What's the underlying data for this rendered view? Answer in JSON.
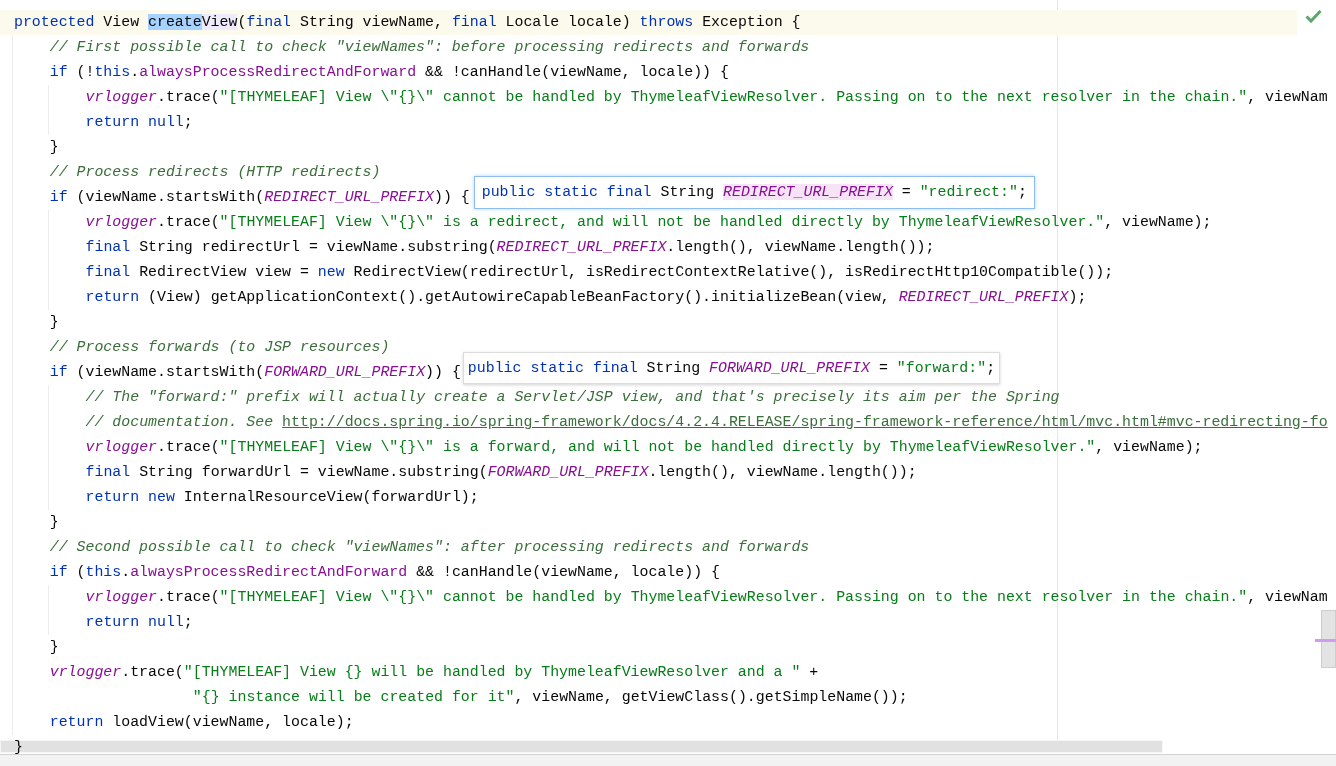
{
  "editor": {
    "lines": [
      {
        "current": true,
        "tokens": [
          {
            "kind": "keyword",
            "text": "protected"
          },
          {
            "kind": "plain",
            "text": " View "
          },
          {
            "kind": "selection",
            "text": "create"
          },
          {
            "kind": "usage",
            "text": "View"
          },
          {
            "kind": "plain",
            "text": "("
          },
          {
            "kind": "keyword",
            "text": "final"
          },
          {
            "kind": "plain",
            "text": " String viewName, "
          },
          {
            "kind": "keyword",
            "text": "final"
          },
          {
            "kind": "plain",
            "text": " Locale locale) "
          },
          {
            "kind": "keyword",
            "text": "throws"
          },
          {
            "kind": "plain",
            "text": " Exception {"
          }
        ],
        "children": [
          {
            "current": false,
            "tokens": [
              {
                "kind": "comment",
                "text": "// First possible call to check \"viewNames\": before processing redirects and forwards"
              }
            ]
          },
          {
            "current": false,
            "tokens": [
              {
                "kind": "keyword",
                "text": "if"
              },
              {
                "kind": "plain",
                "text": " (!"
              },
              {
                "kind": "keyword",
                "text": "this"
              },
              {
                "kind": "plain",
                "text": "."
              },
              {
                "kind": "field",
                "text": "alwaysProcessRedirectAndForward"
              },
              {
                "kind": "plain",
                "text": " && !canHandle(viewName, locale)) {"
              }
            ],
            "children": [
              {
                "current": false,
                "tokens": [
                  {
                    "kind": "static",
                    "text": "vrlogger"
                  },
                  {
                    "kind": "plain",
                    "text": ".trace("
                  },
                  {
                    "kind": "string",
                    "text": "\"[THYMELEAF] View \\\"{}\\\" cannot be handled by ThymeleafViewResolver. Passing on to the next resolver in the chain.\""
                  },
                  {
                    "kind": "plain",
                    "text": ", viewNam"
                  }
                ]
              },
              {
                "current": false,
                "tokens": [
                  {
                    "kind": "keyword",
                    "text": "return null"
                  },
                  {
                    "kind": "plain",
                    "text": ";"
                  }
                ]
              }
            ]
          },
          {
            "current": false,
            "tokens": [
              {
                "kind": "plain",
                "text": "}"
              }
            ]
          },
          {
            "current": false,
            "tokens": [
              {
                "kind": "comment",
                "text": "// Process redirects (HTTP redirects)"
              }
            ]
          },
          {
            "current": false,
            "tokens": [
              {
                "kind": "keyword",
                "text": "if"
              },
              {
                "kind": "plain",
                "text": " (viewName.startsWith("
              },
              {
                "kind": "static",
                "text": "REDIRECT_URL_PREFIX"
              },
              {
                "kind": "plain",
                "text": ")) {"
              }
            ],
            "popup": {
              "focused": true,
              "tokens": [
                {
                  "kind": "keyword",
                  "text": "public static final"
                },
                {
                  "kind": "plain",
                  "text": " String "
                },
                {
                  "kind": "highlighted",
                  "text": "REDIRECT_URL_PREFIX"
                },
                {
                  "kind": "plain",
                  "text": " = "
                },
                {
                  "kind": "string",
                  "text": "\"redirect:\""
                },
                {
                  "kind": "plain",
                  "text": ";"
                }
              ]
            },
            "children": [
              {
                "current": false,
                "tokens": [
                  {
                    "kind": "static",
                    "text": "vrlogger"
                  },
                  {
                    "kind": "plain",
                    "text": ".trace("
                  },
                  {
                    "kind": "string",
                    "text": "\"[THYMELEAF] View \\\"{}\\\" is a redirect, and will not be handled directly by ThymeleafViewResolver.\""
                  },
                  {
                    "kind": "plain",
                    "text": ", viewName);"
                  }
                ]
              },
              {
                "current": false,
                "tokens": [
                  {
                    "kind": "keyword",
                    "text": "final"
                  },
                  {
                    "kind": "plain",
                    "text": " String redirectUrl = viewName.substring("
                  },
                  {
                    "kind": "static",
                    "text": "REDIRECT_URL_PREFIX"
                  },
                  {
                    "kind": "plain",
                    "text": ".length(), viewName.length());"
                  }
                ]
              },
              {
                "current": false,
                "tokens": [
                  {
                    "kind": "keyword",
                    "text": "final"
                  },
                  {
                    "kind": "plain",
                    "text": " RedirectView view = "
                  },
                  {
                    "kind": "keyword",
                    "text": "new"
                  },
                  {
                    "kind": "plain",
                    "text": " RedirectView(redirectUrl, isRedirectContextRelative(), isRedirectHttp10Compatible());"
                  }
                ]
              },
              {
                "current": false,
                "tokens": [
                  {
                    "kind": "keyword",
                    "text": "return"
                  },
                  {
                    "kind": "plain",
                    "text": " (View) getApplicationContext().getAutowireCapableBeanFactory().initializeBean(view, "
                  },
                  {
                    "kind": "static",
                    "text": "REDIRECT_URL_PREFIX"
                  },
                  {
                    "kind": "plain",
                    "text": ");"
                  }
                ]
              }
            ]
          },
          {
            "current": false,
            "tokens": [
              {
                "kind": "plain",
                "text": "}"
              }
            ]
          },
          {
            "current": false,
            "tokens": [
              {
                "kind": "comment",
                "text": "// Process forwards (to JSP resources)"
              }
            ]
          },
          {
            "current": false,
            "tokens": [
              {
                "kind": "keyword",
                "text": "if"
              },
              {
                "kind": "plain",
                "text": " (viewName.startsWith("
              },
              {
                "kind": "static",
                "text": "FORWARD_URL_PREFIX"
              },
              {
                "kind": "plain",
                "text": ")) {"
              }
            ],
            "popup": {
              "focused": false,
              "tokens": [
                {
                  "kind": "keyword",
                  "text": "public static final"
                },
                {
                  "kind": "plain",
                  "text": " String "
                },
                {
                  "kind": "static",
                  "text": "FORWARD_URL_PREFIX"
                },
                {
                  "kind": "plain",
                  "text": " = "
                },
                {
                  "kind": "string",
                  "text": "\"forward:\""
                },
                {
                  "kind": "plain",
                  "text": ";"
                }
              ]
            },
            "children": [
              {
                "current": false,
                "tokens": [
                  {
                    "kind": "comment",
                    "text": "// The \"forward:\" prefix will actually create a Servlet/JSP view, and that's precisely its aim per the Spring"
                  }
                ]
              },
              {
                "current": false,
                "tokens": [
                  {
                    "kind": "comment",
                    "text": "// documentation. See "
                  },
                  {
                    "kind": "link",
                    "text": "http://docs.spring.io/spring-framework/docs/4.2.4.RELEASE/spring-framework-reference/html/mvc.html#mvc-redirecting-fo"
                  }
                ]
              },
              {
                "current": false,
                "tokens": [
                  {
                    "kind": "static",
                    "text": "vrlogger"
                  },
                  {
                    "kind": "plain",
                    "text": ".trace("
                  },
                  {
                    "kind": "string",
                    "text": "\"[THYMELEAF] View \\\"{}\\\" is a forward, and will not be handled directly by ThymeleafViewResolver.\""
                  },
                  {
                    "kind": "plain",
                    "text": ", viewName);"
                  }
                ]
              },
              {
                "current": false,
                "tokens": [
                  {
                    "kind": "keyword",
                    "text": "final"
                  },
                  {
                    "kind": "plain",
                    "text": " String forwardUrl = viewName.substring("
                  },
                  {
                    "kind": "static",
                    "text": "FORWARD_URL_PREFIX"
                  },
                  {
                    "kind": "plain",
                    "text": ".length(), viewName.length());"
                  }
                ]
              },
              {
                "current": false,
                "tokens": [
                  {
                    "kind": "keyword",
                    "text": "return new"
                  },
                  {
                    "kind": "plain",
                    "text": " InternalResourceView(forwardUrl);"
                  }
                ]
              }
            ]
          },
          {
            "current": false,
            "tokens": [
              {
                "kind": "plain",
                "text": "}"
              }
            ]
          },
          {
            "current": false,
            "tokens": [
              {
                "kind": "comment",
                "text": "// Second possible call to check \"viewNames\": after processing redirects and forwards"
              }
            ]
          },
          {
            "current": false,
            "tokens": [
              {
                "kind": "keyword",
                "text": "if"
              },
              {
                "kind": "plain",
                "text": " ("
              },
              {
                "kind": "keyword",
                "text": "this"
              },
              {
                "kind": "plain",
                "text": "."
              },
              {
                "kind": "field",
                "text": "alwaysProcessRedirectAndForward"
              },
              {
                "kind": "plain",
                "text": " && !canHandle(viewName, locale)) {"
              }
            ],
            "children": [
              {
                "current": false,
                "tokens": [
                  {
                    "kind": "static",
                    "text": "vrlogger"
                  },
                  {
                    "kind": "plain",
                    "text": ".trace("
                  },
                  {
                    "kind": "string",
                    "text": "\"[THYMELEAF] View \\\"{}\\\" cannot be handled by ThymeleafViewResolver. Passing on to the next resolver in the chain.\""
                  },
                  {
                    "kind": "plain",
                    "text": ", viewNam"
                  }
                ]
              },
              {
                "current": false,
                "tokens": [
                  {
                    "kind": "keyword",
                    "text": "return null"
                  },
                  {
                    "kind": "plain",
                    "text": ";"
                  }
                ]
              }
            ]
          },
          {
            "current": false,
            "tokens": [
              {
                "kind": "plain",
                "text": "}"
              }
            ]
          },
          {
            "current": false,
            "tokens": [
              {
                "kind": "static",
                "text": "vrlogger"
              },
              {
                "kind": "plain",
                "text": ".trace("
              },
              {
                "kind": "string",
                "text": "\"[THYMELEAF] View {} will be handled by ThymeleafViewResolver and a \""
              },
              {
                "kind": "plain",
                "text": " +"
              }
            ],
            "continued": [
              {
                "current": false,
                "tokens": [
                  {
                    "kind": "string",
                    "text": "\"{} instance will be created for it\""
                  },
                  {
                    "kind": "plain",
                    "text": ", viewName, getViewClass().getSimpleName());"
                  }
                ]
              }
            ]
          },
          {
            "current": false,
            "tokens": [
              {
                "kind": "keyword",
                "text": "return"
              },
              {
                "kind": "plain",
                "text": " loadView(viewName, locale);"
              }
            ]
          }
        ]
      },
      {
        "current": false,
        "tokens": [
          {
            "kind": "plain",
            "text": "}"
          }
        ]
      }
    ]
  }
}
